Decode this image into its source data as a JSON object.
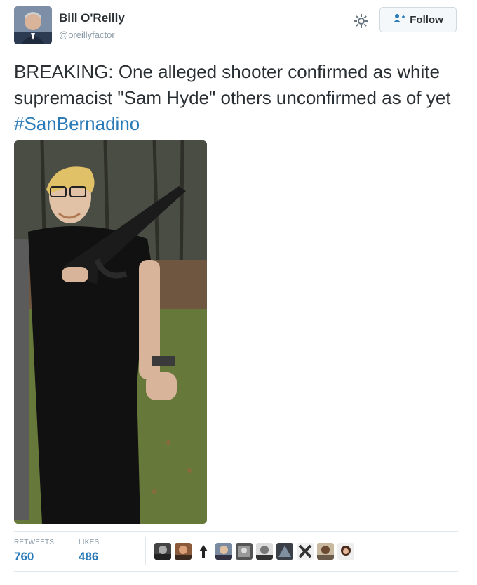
{
  "user": {
    "name": "Bill O'Reilly",
    "handle": "@oreillyfactor"
  },
  "actions": {
    "follow_label": "Follow",
    "settings_icon": "gear-icon",
    "follow_icon": "add-user-icon"
  },
  "tweet": {
    "text": "BREAKING: One alleged shooter confirmed as white supremacist \"Sam Hyde\" others unconfirmed as of yet ",
    "hashtag": "#SanBernadino"
  },
  "stats": {
    "retweets_label": "RETWEETS",
    "retweets": "760",
    "likes_label": "LIKES",
    "likes": "486"
  },
  "colors": {
    "text": "#292f33",
    "muted": "#8899a6",
    "link": "#2b7bb9",
    "border": "#e1e8ed"
  }
}
